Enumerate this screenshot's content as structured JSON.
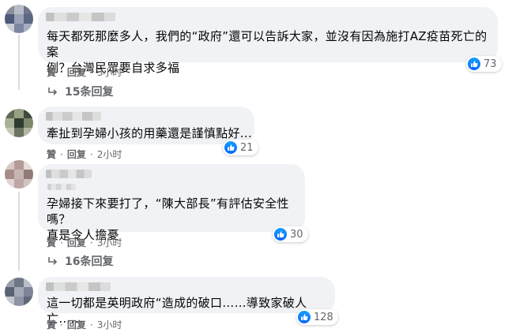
{
  "comments": [
    {
      "text": "每天都死那麼多人，我們的“政府”還可以告訴大家，並沒有因為施打AZ疫苗死亡的案\n例？台灣民眾要自求多福",
      "reactions": "73",
      "like": "贊",
      "reply": "回复",
      "time": "3小时",
      "replies": "15条回复"
    },
    {
      "text": "牽扯到孕婦小孩的用藥還是謹慎點好...",
      "reactions": "21",
      "like": "贊",
      "reply": "回复",
      "time": "2小时"
    },
    {
      "text": "孕婦接下來要打了，“陳大部長”有評估安全性嗎？\n真是令人擔憂",
      "reactions": "30",
      "like": "贊",
      "reply": "回复",
      "time": "3小时",
      "replies": "16条回复"
    },
    {
      "text": "這一切都是英明政府“造成的破口……導致家破人亡……",
      "reactions": "128",
      "like": "贊",
      "reply": "回复",
      "time": "3小时"
    }
  ],
  "colors": {
    "like_blue": "#0866ff",
    "bubble_bg": "#f0f2f5",
    "meta_gray": "#65676b"
  },
  "icons": {
    "reaction": "thumbs-up-icon",
    "replies": "reply-arrow-icon"
  }
}
